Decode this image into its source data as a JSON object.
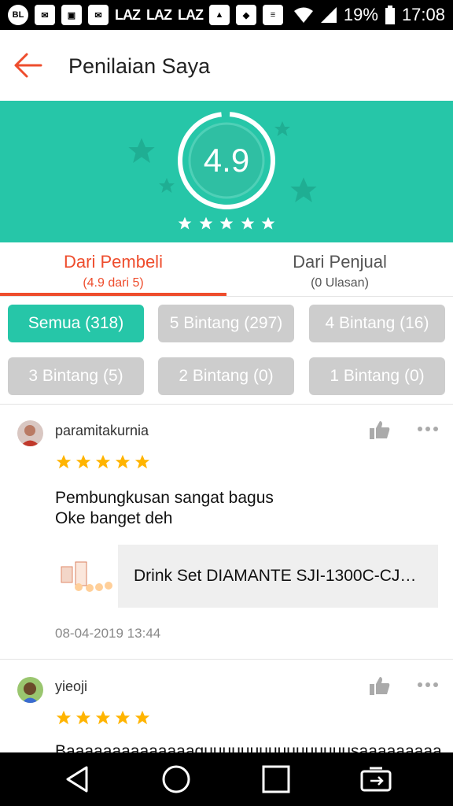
{
  "status_bar": {
    "left_icons": [
      "BL",
      "lazada-icon",
      "contact-icon",
      "lazada-icon"
    ],
    "laz_labels": [
      "LAZ",
      "LAZ",
      "LAZ"
    ],
    "battery": "19%",
    "time": "17:08"
  },
  "header": {
    "title": "Penilaian Saya"
  },
  "rating": {
    "score": "4.9",
    "stars": 5
  },
  "tabs": [
    {
      "label": "Dari Pembeli",
      "sub": "(4.9 dari 5)"
    },
    {
      "label": "Dari Penjual",
      "sub": "(0 Ulasan)"
    }
  ],
  "filters": [
    "Semua (318)",
    "5 Bintang (297)",
    "4 Bintang (16)",
    "3 Bintang (5)",
    "2 Bintang (0)",
    "1 Bintang (0)"
  ],
  "reviews": [
    {
      "user": "paramitakurnia",
      "stars": 5,
      "text_lines": [
        "Pembungkusan sangat bagus",
        "Oke banget deh"
      ],
      "product": "Drink Set DIAMANTE SJI-1300C-CJ…",
      "date": "08-04-2019 13:44"
    },
    {
      "user": "yieoji",
      "stars": 5,
      "text_lines": [
        "Baaaaaaaaaaaaaaguuuuuuuuuuuuuuuusaaaaaaaaa"
      ]
    }
  ],
  "colors": {
    "accent": "#ee4d2d",
    "teal": "#26c6a8",
    "star": "#ffb400"
  }
}
